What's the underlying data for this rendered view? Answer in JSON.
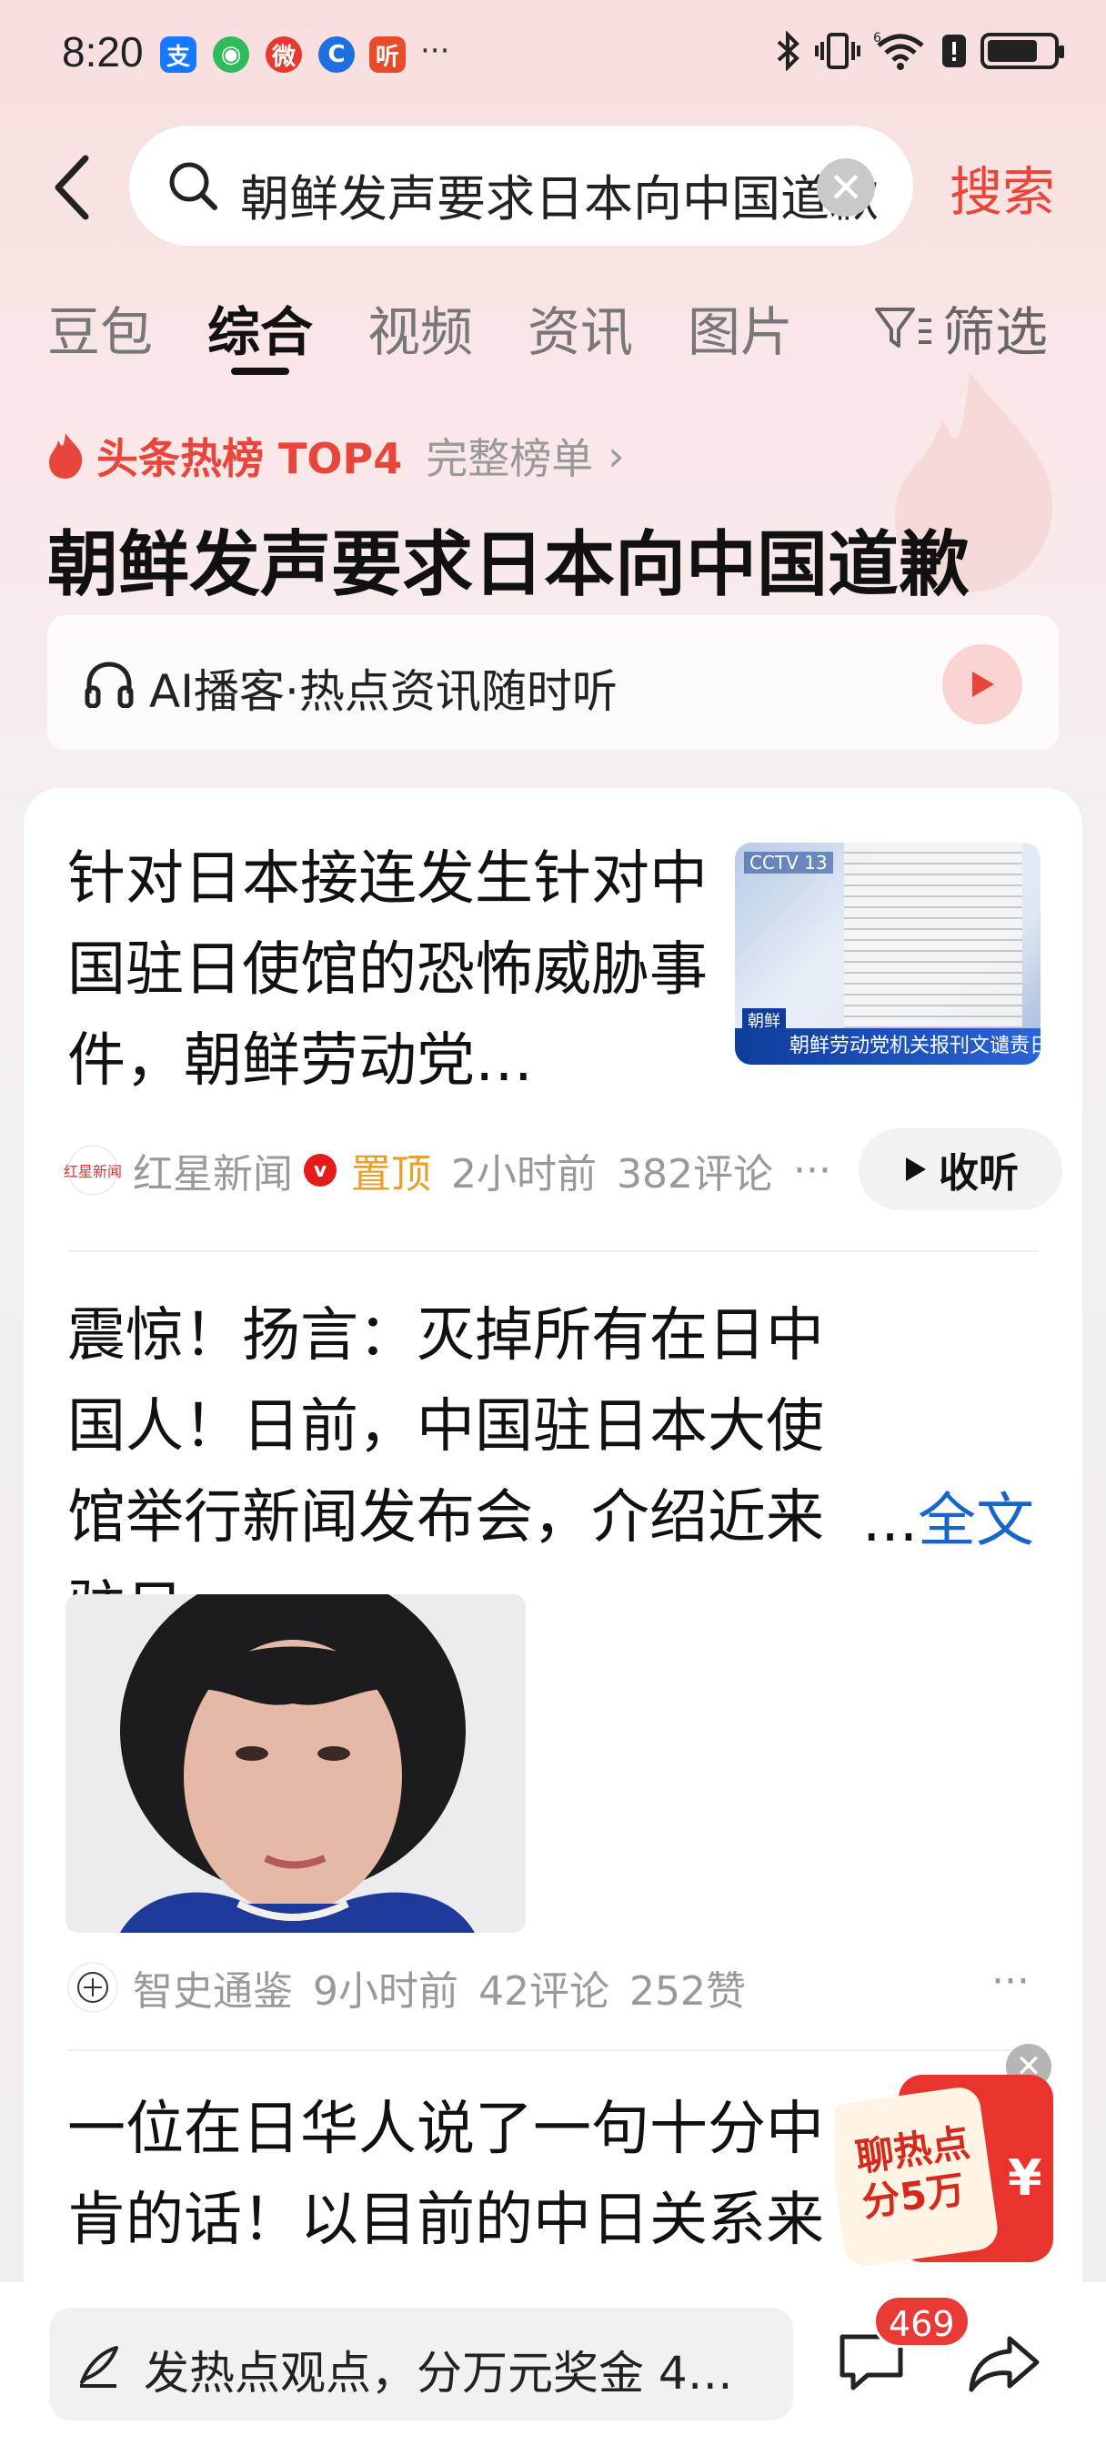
{
  "status_bar": {
    "time": "8:20",
    "app_icons": [
      "支",
      "◉",
      "微",
      "C",
      "听"
    ],
    "more": "···",
    "signal_label": "6"
  },
  "search": {
    "query": "朝鲜发声要求日本向中国道歉",
    "clear_glyph": "✕",
    "button_label": "搜索"
  },
  "tabs": [
    {
      "label": "豆包"
    },
    {
      "label": "综合"
    },
    {
      "label": "视频"
    },
    {
      "label": "资讯"
    },
    {
      "label": "图片"
    }
  ],
  "filter_label": "筛选",
  "hot": {
    "label": "头条热榜 TOP4",
    "full_list": "完整榜单",
    "chevron": "›",
    "title": "朝鲜发声要求日本向中国道歉"
  },
  "podcast": {
    "text": "AI播客·热点资讯随时听"
  },
  "articles": [
    {
      "title": "针对日本接连发生针对中国驻日使馆的恐怖威胁事件，朝鲜劳动党…",
      "thumb_caption": "朝鲜劳动党机关报刊文谴责日本",
      "thumb_tag": "朝鲜",
      "thumb_tv": "CCTV 13",
      "source": "红星新闻",
      "source_logo": "红星新闻",
      "verified": "v",
      "pinned": "置顶",
      "time": "2小时前",
      "comments": "382评论",
      "more": "···",
      "listen": "收听"
    },
    {
      "title": "震惊！扬言：灭掉所有在日中国人！日前，中国驻日本大使馆举行新闻发布会，介绍近来驻日",
      "ellipsis": "...",
      "full_text": "全文",
      "source": "智史通鉴",
      "time": "9小时前",
      "comments": "42评论",
      "likes": "252赞",
      "more": "···"
    },
    {
      "title": "一位在日华人说了一句十分中肯的话！以目前的中日关系来看，"
    }
  ],
  "promo": {
    "text": "聊热点\n分5万",
    "currency": "¥",
    "close": "✕"
  },
  "bottom": {
    "comment_placeholder": "发热点观点，分万元奖金 4…",
    "comment_count": "469"
  },
  "colors": {
    "accent_red": "#e8463b",
    "link_blue": "#1665c9",
    "pin_orange": "#e8a02b"
  }
}
